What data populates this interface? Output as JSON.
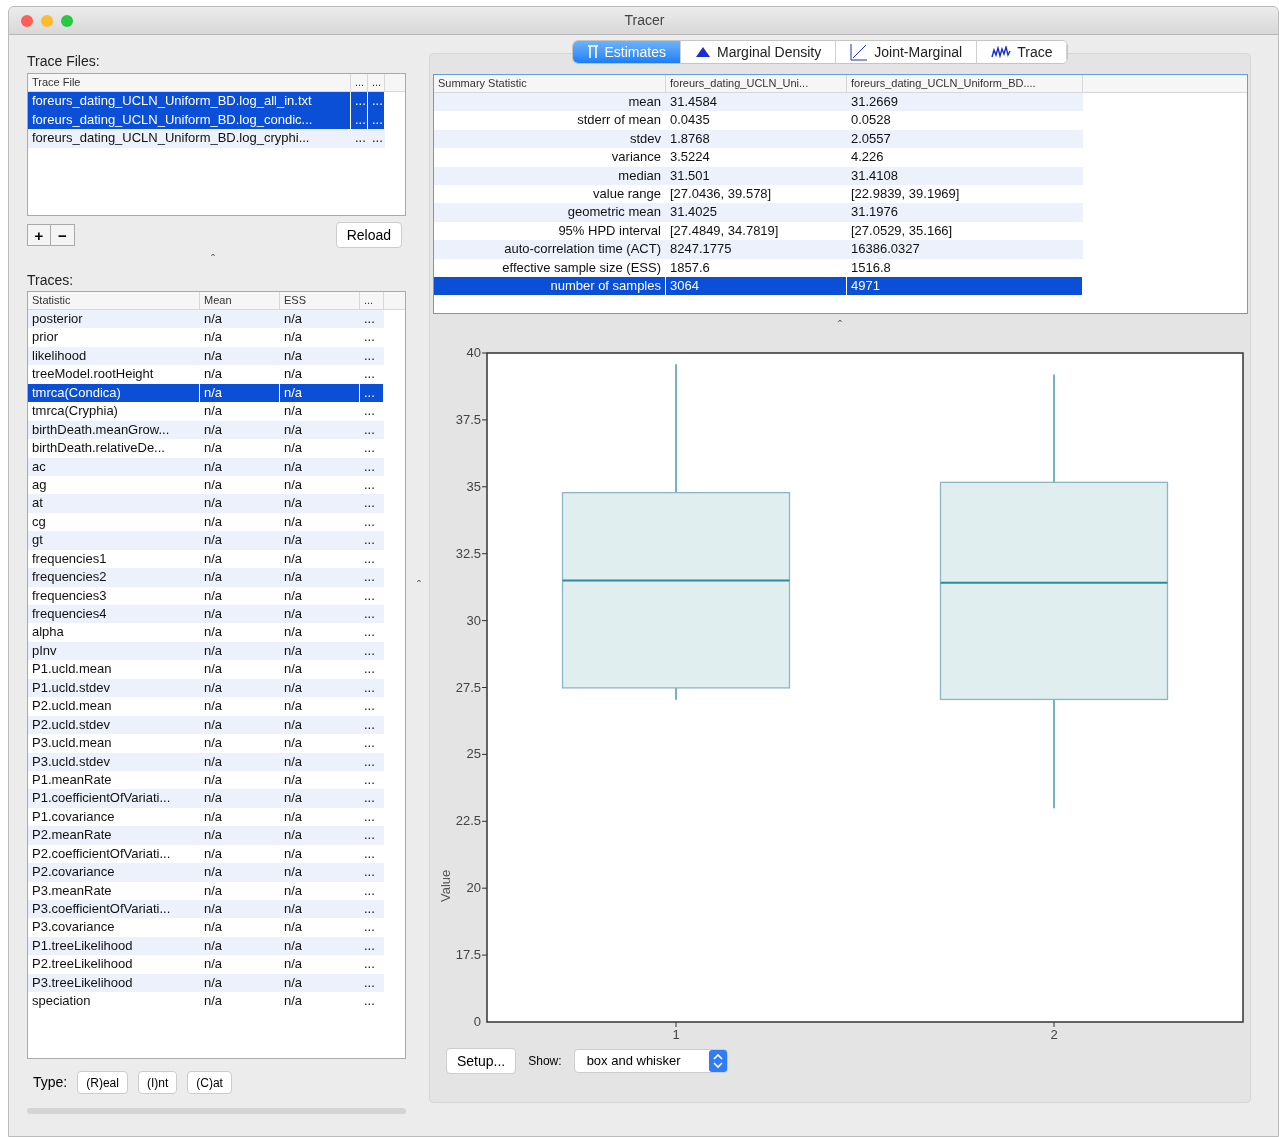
{
  "window": {
    "title": "Tracer"
  },
  "trace_files": {
    "label": "Trace Files:",
    "columns": [
      "Trace File",
      "...",
      "..."
    ],
    "rows": [
      {
        "cells": [
          "foreurs_dating_UCLN_Uniform_BD.log_all_in.txt",
          "...",
          "..."
        ],
        "selected": true
      },
      {
        "cells": [
          "foreurs_dating_UCLN_Uniform_BD.log_condic...",
          "...",
          "..."
        ],
        "selected": true
      },
      {
        "cells": [
          "foreurs_dating_UCLN_Uniform_BD.log_cryphi...",
          "...",
          "..."
        ],
        "selected": false
      }
    ],
    "add_button": "+",
    "remove_button": "−",
    "reload_button": "Reload"
  },
  "splitter_marks": [
    "ˆ",
    "ˆ",
    "ˆ"
  ],
  "traces": {
    "label": "Traces:",
    "columns": [
      "Statistic",
      "Mean",
      "ESS",
      "..."
    ],
    "rows": [
      {
        "cells": [
          "posterior",
          "n/a",
          "n/a",
          "..."
        ],
        "selected": false
      },
      {
        "cells": [
          "prior",
          "n/a",
          "n/a",
          "..."
        ],
        "selected": false
      },
      {
        "cells": [
          "likelihood",
          "n/a",
          "n/a",
          "..."
        ],
        "selected": false
      },
      {
        "cells": [
          "treeModel.rootHeight",
          "n/a",
          "n/a",
          "..."
        ],
        "selected": false
      },
      {
        "cells": [
          "tmrca(Condica)",
          "n/a",
          "n/a",
          "..."
        ],
        "selected": true
      },
      {
        "cells": [
          "tmrca(Cryphia)",
          "n/a",
          "n/a",
          "..."
        ],
        "selected": false
      },
      {
        "cells": [
          "birthDeath.meanGrow...",
          "n/a",
          "n/a",
          "..."
        ],
        "selected": false
      },
      {
        "cells": [
          "birthDeath.relativeDe...",
          "n/a",
          "n/a",
          "..."
        ],
        "selected": false
      },
      {
        "cells": [
          "ac",
          "n/a",
          "n/a",
          "..."
        ],
        "selected": false
      },
      {
        "cells": [
          "ag",
          "n/a",
          "n/a",
          "..."
        ],
        "selected": false
      },
      {
        "cells": [
          "at",
          "n/a",
          "n/a",
          "..."
        ],
        "selected": false
      },
      {
        "cells": [
          "cg",
          "n/a",
          "n/a",
          "..."
        ],
        "selected": false
      },
      {
        "cells": [
          "gt",
          "n/a",
          "n/a",
          "..."
        ],
        "selected": false
      },
      {
        "cells": [
          "frequencies1",
          "n/a",
          "n/a",
          "..."
        ],
        "selected": false
      },
      {
        "cells": [
          "frequencies2",
          "n/a",
          "n/a",
          "..."
        ],
        "selected": false
      },
      {
        "cells": [
          "frequencies3",
          "n/a",
          "n/a",
          "..."
        ],
        "selected": false
      },
      {
        "cells": [
          "frequencies4",
          "n/a",
          "n/a",
          "..."
        ],
        "selected": false
      },
      {
        "cells": [
          "alpha",
          "n/a",
          "n/a",
          "..."
        ],
        "selected": false
      },
      {
        "cells": [
          "pInv",
          "n/a",
          "n/a",
          "..."
        ],
        "selected": false
      },
      {
        "cells": [
          "P1.ucld.mean",
          "n/a",
          "n/a",
          "..."
        ],
        "selected": false
      },
      {
        "cells": [
          "P1.ucld.stdev",
          "n/a",
          "n/a",
          "..."
        ],
        "selected": false
      },
      {
        "cells": [
          "P2.ucld.mean",
          "n/a",
          "n/a",
          "..."
        ],
        "selected": false
      },
      {
        "cells": [
          "P2.ucld.stdev",
          "n/a",
          "n/a",
          "..."
        ],
        "selected": false
      },
      {
        "cells": [
          "P3.ucld.mean",
          "n/a",
          "n/a",
          "..."
        ],
        "selected": false
      },
      {
        "cells": [
          "P3.ucld.stdev",
          "n/a",
          "n/a",
          "..."
        ],
        "selected": false
      },
      {
        "cells": [
          "P1.meanRate",
          "n/a",
          "n/a",
          "..."
        ],
        "selected": false
      },
      {
        "cells": [
          "P1.coefficientOfVariati...",
          "n/a",
          "n/a",
          "..."
        ],
        "selected": false
      },
      {
        "cells": [
          "P1.covariance",
          "n/a",
          "n/a",
          "..."
        ],
        "selected": false
      },
      {
        "cells": [
          "P2.meanRate",
          "n/a",
          "n/a",
          "..."
        ],
        "selected": false
      },
      {
        "cells": [
          "P2.coefficientOfVariati...",
          "n/a",
          "n/a",
          "..."
        ],
        "selected": false
      },
      {
        "cells": [
          "P2.covariance",
          "n/a",
          "n/a",
          "..."
        ],
        "selected": false
      },
      {
        "cells": [
          "P3.meanRate",
          "n/a",
          "n/a",
          "..."
        ],
        "selected": false
      },
      {
        "cells": [
          "P3.coefficientOfVariati...",
          "n/a",
          "n/a",
          "..."
        ],
        "selected": false
      },
      {
        "cells": [
          "P3.covariance",
          "n/a",
          "n/a",
          "..."
        ],
        "selected": false
      },
      {
        "cells": [
          "P1.treeLikelihood",
          "n/a",
          "n/a",
          "..."
        ],
        "selected": false
      },
      {
        "cells": [
          "P2.treeLikelihood",
          "n/a",
          "n/a",
          "..."
        ],
        "selected": false
      },
      {
        "cells": [
          "P3.treeLikelihood",
          "n/a",
          "n/a",
          "..."
        ],
        "selected": false
      },
      {
        "cells": [
          "speciation",
          "n/a",
          "n/a",
          "..."
        ],
        "selected": false
      }
    ]
  },
  "type_bar": {
    "label": "Type:",
    "buttons": [
      "(R)eal",
      "(I)nt",
      "(C)at"
    ]
  },
  "tabs": [
    {
      "label": "Estimates",
      "kind": "estimates",
      "selected": true
    },
    {
      "label": "Marginal Density",
      "kind": "density",
      "selected": false
    },
    {
      "label": "Joint-Marginal",
      "kind": "joint",
      "selected": false
    },
    {
      "label": "Trace",
      "kind": "trace",
      "selected": false
    }
  ],
  "summary": {
    "columns": [
      "Summary Statistic",
      "foreurs_dating_UCLN_Uni...",
      "foreurs_dating_UCLN_Uniform_BD...."
    ],
    "rows": [
      {
        "cells": [
          "mean",
          "31.4584",
          "31.2669"
        ],
        "selected": false
      },
      {
        "cells": [
          "stderr of mean",
          "0.0435",
          "0.0528"
        ],
        "selected": false
      },
      {
        "cells": [
          "stdev",
          "1.8768",
          "2.0557"
        ],
        "selected": false
      },
      {
        "cells": [
          "variance",
          "3.5224",
          "4.226"
        ],
        "selected": false
      },
      {
        "cells": [
          "median",
          "31.501",
          "31.4108"
        ],
        "selected": false
      },
      {
        "cells": [
          "value range",
          "[27.0436, 39.578]",
          "[22.9839, 39.1969]"
        ],
        "selected": false
      },
      {
        "cells": [
          "geometric mean",
          "31.4025",
          "31.1976"
        ],
        "selected": false
      },
      {
        "cells": [
          "95% HPD interval",
          "[27.4849, 34.7819]",
          "[27.0529, 35.166]"
        ],
        "selected": false
      },
      {
        "cells": [
          "auto-correlation time (ACT)",
          "8247.1775",
          "16386.0327"
        ],
        "selected": false
      },
      {
        "cells": [
          "effective sample size (ESS)",
          "1857.6",
          "1516.8"
        ],
        "selected": false
      },
      {
        "cells": [
          "number of samples",
          "3064",
          "4971"
        ],
        "selected": true
      }
    ]
  },
  "chart_data": {
    "type": "box",
    "ylabel": "Value",
    "categories": [
      "1",
      "2"
    ],
    "ylim": [
      15,
      40
    ],
    "yticks": [
      17.5,
      20,
      22.5,
      25,
      27.5,
      30,
      32.5,
      35,
      37.5,
      40
    ]
  },
  "axis_origin_label": "0",
  "bottom_bar": {
    "setup_button": "Setup...",
    "show_label": "Show:",
    "show_value": "box and whisker"
  }
}
